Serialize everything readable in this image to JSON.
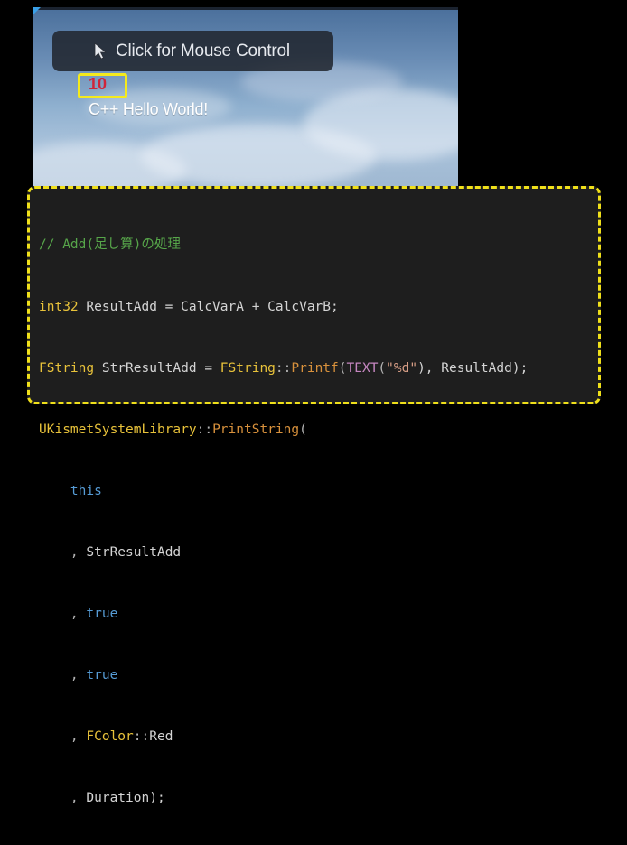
{
  "viewport": {
    "mouse_control_label": "Click for Mouse Control",
    "counter_value": "10",
    "hello_text": "C++ Hello World!",
    "icons": {
      "cursor": "mouse-cursor-icon"
    }
  },
  "code": {
    "line1": {
      "comment": "// Add(足し算)の処理"
    },
    "line2": {
      "type": "int32",
      "rest": " ResultAdd = CalcVarA + CalcVarB;"
    },
    "line3": {
      "type1": "FString",
      "id1": " StrResultAdd = ",
      "type2": "FString",
      "scope": "::",
      "func": "Printf",
      "p1": "(",
      "macro": "TEXT",
      "p2": "(",
      "str": "\"%d\"",
      "p3": "), ResultAdd);"
    },
    "line4": {
      "type": "UKismetSystemLibrary",
      "scope": "::",
      "func": "PrintString",
      "p": "("
    },
    "line5": {
      "indent": "    ",
      "kw": "this"
    },
    "line6": {
      "indent": "    ",
      "p": ", ",
      "id": "StrResultAdd"
    },
    "line7": {
      "indent": "    ",
      "p": ", ",
      "kw": "true"
    },
    "line8": {
      "indent": "    ",
      "p": ", ",
      "kw": "true"
    },
    "line9": {
      "indent": "    ",
      "p": ", ",
      "type": "FColor",
      "scope": "::",
      "id": "Red"
    },
    "line10": {
      "indent": "    ",
      "p": ", ",
      "id": "Duration);"
    }
  },
  "colors": {
    "highlight_border": "#f0e01a",
    "counter_text": "#d0243a",
    "code_background": "#1e1e1e"
  }
}
